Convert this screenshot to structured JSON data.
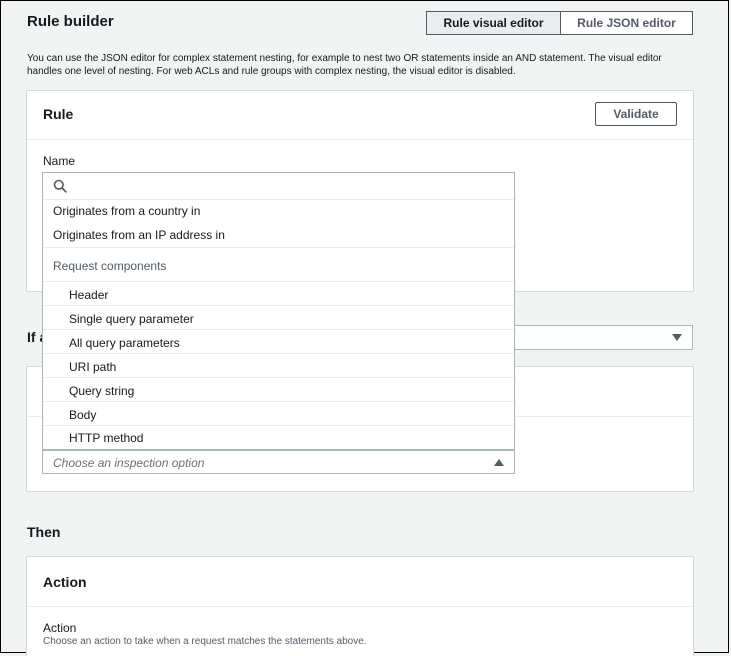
{
  "header": {
    "title": "Rule builder",
    "tabs": [
      {
        "label": "Rule visual editor",
        "active": true
      },
      {
        "label": "Rule JSON editor",
        "active": false
      }
    ],
    "description": "You can use the JSON editor for complex statement nesting, for example to nest two OR statements inside an AND statement. The visual editor handles one level of nesting. For web ACLs and rule groups with complex nesting, the visual editor is disabled."
  },
  "rule_panel": {
    "title": "Rule",
    "validate_label": "Validate",
    "name_label": "Name"
  },
  "if_section": {
    "title_fragment": "If a"
  },
  "dropdown": {
    "search_placeholder": "",
    "top_options": [
      "Originates from a country in",
      "Originates from an IP address in"
    ],
    "group_label": "Request components",
    "component_options": [
      "Header",
      "Single query parameter",
      "All query parameters",
      "URI path",
      "Query string",
      "Body",
      "HTTP method"
    ]
  },
  "inspection_select": {
    "placeholder": "Choose an inspection option"
  },
  "then_section": {
    "title": "Then",
    "action_panel": {
      "title": "Action",
      "field_label": "Action",
      "field_description": "Choose an action to take when a request matches the statements above."
    }
  },
  "colors": {
    "page_bg": "#f2f3f3",
    "panel_border": "#d5dbdb",
    "active_tab_bg": "#eaeded",
    "text": "#16191f",
    "muted_text": "#545b64"
  }
}
